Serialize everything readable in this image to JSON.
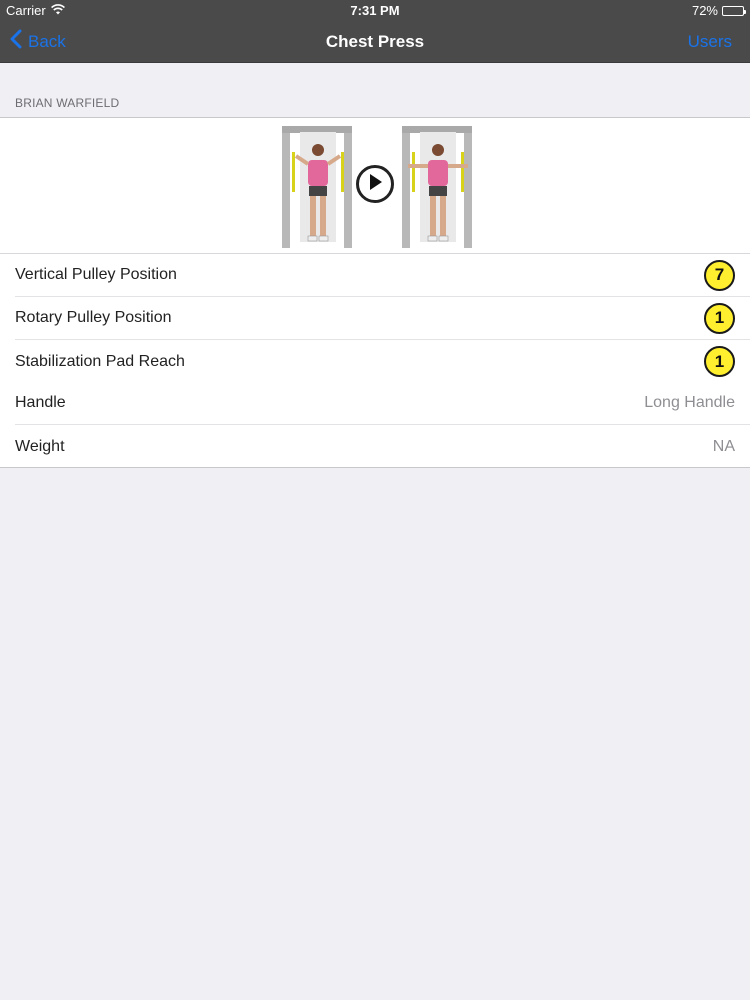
{
  "status": {
    "carrier": "Carrier",
    "time": "7:31 PM",
    "battery": "72%",
    "battery_level": 0.72
  },
  "nav": {
    "back_label": "Back",
    "title": "Chest Press",
    "right_label": "Users"
  },
  "section": {
    "header": "BRIAN WARFIELD"
  },
  "settings": [
    {
      "label": "Vertical Pulley Position",
      "badge": "7"
    },
    {
      "label": "Rotary Pulley Position",
      "badge": "1"
    },
    {
      "label": "Stabilization Pad Reach",
      "badge": "1"
    }
  ],
  "details": [
    {
      "label": "Handle",
      "value": "Long Handle"
    },
    {
      "label": "Weight",
      "value": "NA"
    }
  ],
  "colors": {
    "bar_bg": "#4a4a4a",
    "accent": "#1a73e8",
    "badge_fill": "#ffef2e"
  },
  "icons": {
    "back": "chevron-left-icon",
    "wifi": "wifi-icon",
    "play": "play-icon"
  }
}
